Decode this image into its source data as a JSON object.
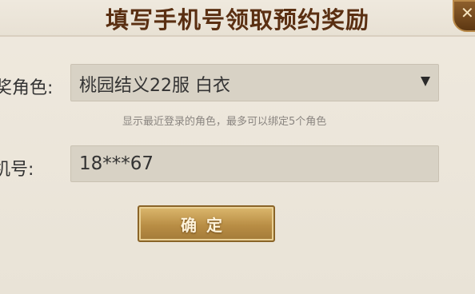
{
  "dialog": {
    "title": "填写手机号领取预约奖励"
  },
  "close_button": {
    "icon": "close-icon",
    "glyph": "✕"
  },
  "role_field": {
    "label": "奖角色:",
    "selected_value": "桃园结义22服 白衣",
    "hint": "显示最近登录的角色，最多可以绑定5个角色"
  },
  "phone_field": {
    "label": "机号:",
    "value": "18***67"
  },
  "confirm_button": {
    "label": "确定"
  },
  "colors": {
    "title": "#5a2f12",
    "panel_bg": "#ece6da",
    "field_bg": "#d8d2c5",
    "button_gold": "#c49a52"
  }
}
